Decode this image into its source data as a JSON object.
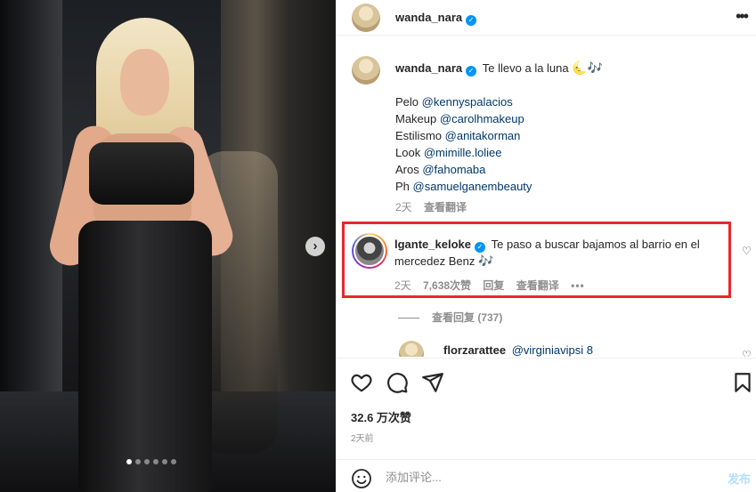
{
  "post": {
    "author": "wanda_nara",
    "caption_text": "Te llevo a la luna",
    "caption_emojis": "🌜🎶",
    "credits": [
      {
        "label": "Pelo",
        "handle": "@kennyspalacios"
      },
      {
        "label": "Makeup",
        "handle": "@carolhmakeup"
      },
      {
        "label": "Estilismo",
        "handle": "@anitakorman"
      },
      {
        "label": "Look",
        "handle": "@mimille.loliee"
      },
      {
        "label": "Aros",
        "handle": "@fahomaba"
      },
      {
        "label": "Ph",
        "handle": "@samuelganembeauty"
      }
    ],
    "caption_age": "2天",
    "see_translation": "查看翻译",
    "photo_dots": [
      true,
      false,
      false,
      false,
      false,
      false
    ]
  },
  "highlighted_comment": {
    "author": "lgante_keloke",
    "text": "Te paso a buscar bajamos al barrio en el mercedez Benz",
    "emoji": "🎶",
    "age": "2天",
    "likes": "7,638次赞",
    "reply": "回复",
    "see_translation": "查看翻译",
    "more": "•••",
    "view_replies": "查看回复 (737)"
  },
  "next_comment": {
    "author": "florzarattee",
    "text": "@virginiavipsi 8"
  },
  "footer": {
    "likes": "32.6 万次赞",
    "time": "2天前",
    "comment_placeholder": "添加评论...",
    "post_button": "发布"
  },
  "icons": {
    "like": "heart-icon",
    "comment": "comment-icon",
    "share": "share-icon",
    "save": "bookmark-icon",
    "emoji": "emoji-icon",
    "more": "more-icon",
    "next": "chevron-right-icon"
  },
  "colors": {
    "link": "#00376b",
    "verified": "#0095f6",
    "highlight_border": "#e8282b",
    "muted": "#8e8e8e"
  }
}
